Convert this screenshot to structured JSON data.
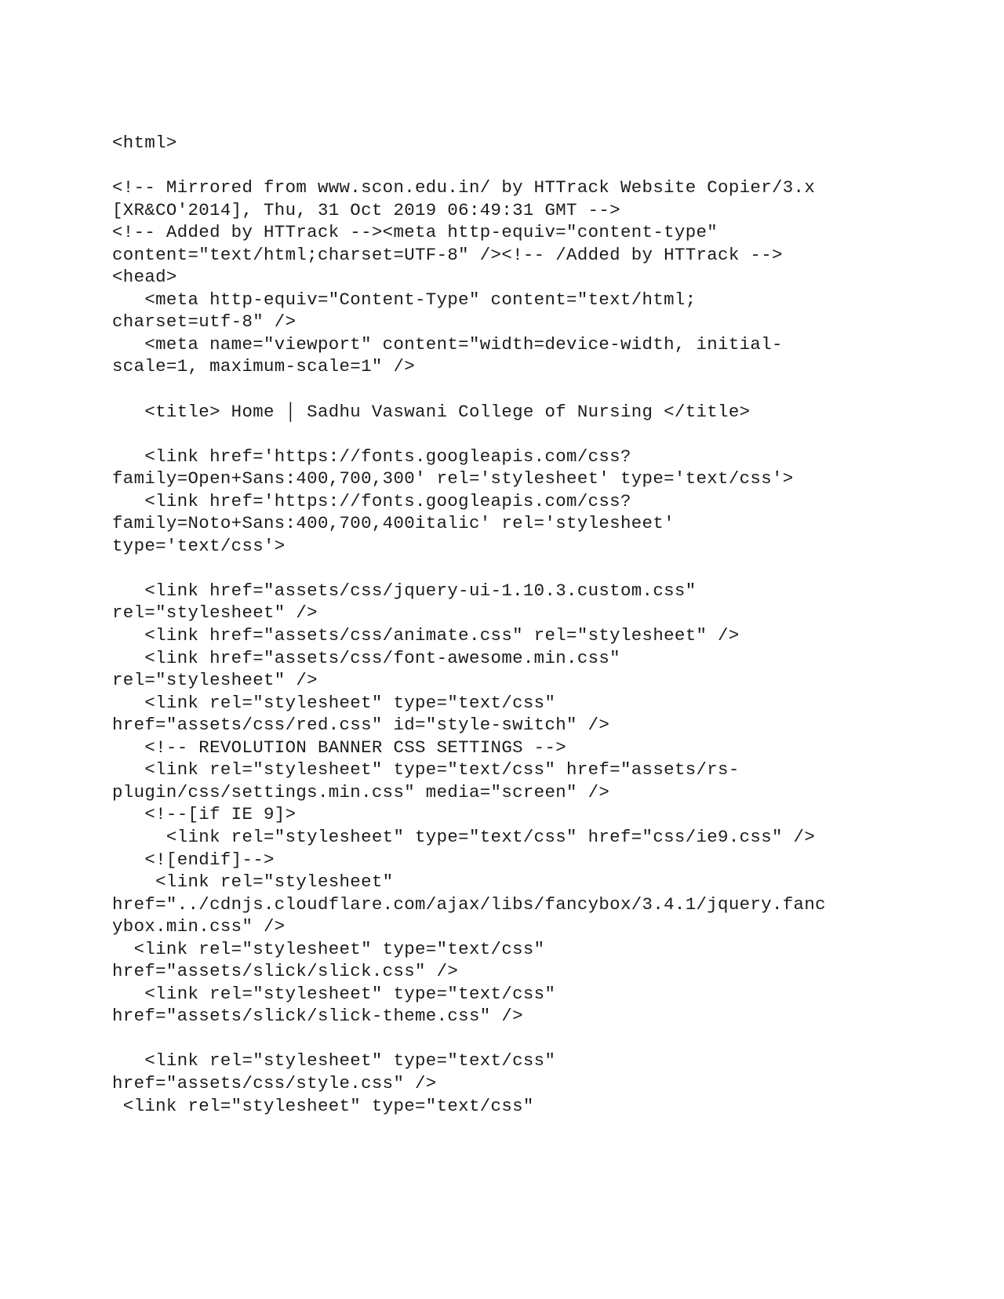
{
  "document": {
    "type": "html-source-listing",
    "lines": [
      "<html>",
      "",
      "<!-- Mirrored from www.scon.edu.in/ by HTTrack Website Copier/3.x",
      "[XR&CO'2014], Thu, 31 Oct 2019 06:49:31 GMT -->",
      "<!-- Added by HTTrack --><meta http-equiv=\"content-type\"",
      "content=\"text/html;charset=UTF-8\" /><!-- /Added by HTTrack -->",
      "<head>",
      "   <meta http-equiv=\"Content-Type\" content=\"text/html;",
      "charset=utf-8\" />",
      "   <meta name=\"viewport\" content=\"width=device-width, initial-",
      "scale=1, maximum-scale=1\" />",
      "",
      "   <title> Home │ Sadhu Vaswani College of Nursing </title>",
      "",
      "   <link href='https://fonts.googleapis.com/css?",
      "family=Open+Sans:400,700,300' rel='stylesheet' type='text/css'>",
      "   <link href='https://fonts.googleapis.com/css?",
      "family=Noto+Sans:400,700,400italic' rel='stylesheet'",
      "type='text/css'>",
      "",
      "   <link href=\"assets/css/jquery-ui-1.10.3.custom.css\"",
      "rel=\"stylesheet\" />",
      "   <link href=\"assets/css/animate.css\" rel=\"stylesheet\" />",
      "   <link href=\"assets/css/font-awesome.min.css\"",
      "rel=\"stylesheet\" />",
      "   <link rel=\"stylesheet\" type=\"text/css\"",
      "href=\"assets/css/red.css\" id=\"style-switch\" />",
      "   <!-- REVOLUTION BANNER CSS SETTINGS -->",
      "   <link rel=\"stylesheet\" type=\"text/css\" href=\"assets/rs-",
      "plugin/css/settings.min.css\" media=\"screen\" />",
      "   <!--[if IE 9]>",
      "     <link rel=\"stylesheet\" type=\"text/css\" href=\"css/ie9.css\" />",
      "   <![endif]-->",
      "    <link rel=\"stylesheet\"",
      "href=\"../cdnjs.cloudflare.com/ajax/libs/fancybox/3.4.1/jquery.fanc",
      "ybox.min.css\" />",
      "  <link rel=\"stylesheet\" type=\"text/css\"",
      "href=\"assets/slick/slick.css\" />",
      "   <link rel=\"stylesheet\" type=\"text/css\"",
      "href=\"assets/slick/slick-theme.css\" />",
      "",
      "   <link rel=\"stylesheet\" type=\"text/css\"",
      "href=\"assets/css/style.css\" />",
      " <link rel=\"stylesheet\" type=\"text/css\""
    ]
  },
  "colors": {
    "background": "#ffffff",
    "text": "#1c1c1c"
  }
}
